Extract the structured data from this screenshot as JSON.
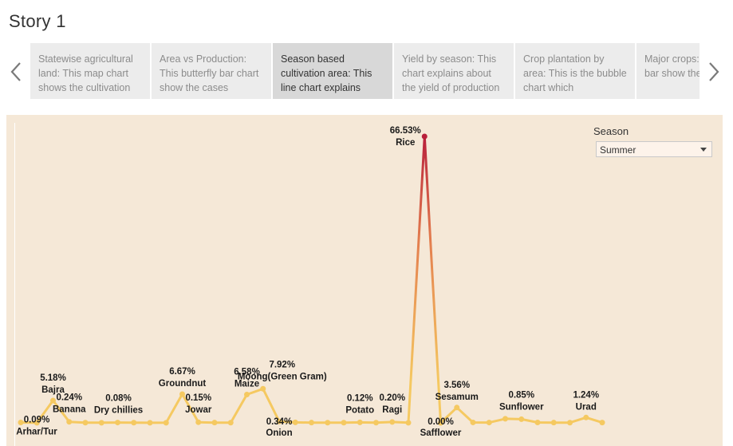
{
  "story": {
    "title": "Story 1"
  },
  "storypoints": [
    {
      "text": "Statewise agricultural land: This map chart shows the cultivation",
      "active": false
    },
    {
      "text": "Area vs Production: This butterfly bar chart show the cases",
      "active": false
    },
    {
      "text": "Season based cultivation area: This line chart explains",
      "active": true
    },
    {
      "text": "Yield by season: This chart explains about the yield of production",
      "active": false
    },
    {
      "text": "Crop plantation by area: This is the bubble chart which",
      "active": false
    },
    {
      "text": "Major crops: stacked bar show the crops",
      "active": false
    }
  ],
  "filter": {
    "label": "Season",
    "value": "Summer"
  },
  "colors": {
    "low": "#f5c961",
    "mid": "#e4804f",
    "high": "#b81f3a",
    "background": "#f5e8d7"
  },
  "chart_data": {
    "type": "line",
    "ylim": [
      0,
      70
    ],
    "points": [
      {
        "crop": "Arhar/Tur",
        "value": 0.09,
        "label": "0.09%",
        "labeled": true
      },
      {
        "crop": "",
        "value": 0.02,
        "label": "",
        "labeled": false
      },
      {
        "crop": "Bajra",
        "value": 5.18,
        "label": "5.18%",
        "labeled": true
      },
      {
        "crop": "Banana",
        "value": 0.24,
        "label": "0.24%",
        "labeled": true
      },
      {
        "crop": "",
        "value": 0.05,
        "label": "",
        "labeled": false
      },
      {
        "crop": "",
        "value": 0.03,
        "label": "",
        "labeled": false
      },
      {
        "crop": "Dry chillies",
        "value": 0.08,
        "label": "0.08%",
        "labeled": true
      },
      {
        "crop": "",
        "value": 0.04,
        "label": "",
        "labeled": false
      },
      {
        "crop": "",
        "value": 0.02,
        "label": "",
        "labeled": false
      },
      {
        "crop": "",
        "value": 0.03,
        "label": "",
        "labeled": false
      },
      {
        "crop": "Groundnut",
        "value": 6.67,
        "label": "6.67%",
        "labeled": true
      },
      {
        "crop": "Jowar",
        "value": 0.15,
        "label": "0.15%",
        "labeled": true
      },
      {
        "crop": "",
        "value": 0.06,
        "label": "",
        "labeled": false
      },
      {
        "crop": "",
        "value": 0.04,
        "label": "",
        "labeled": false
      },
      {
        "crop": "Maize",
        "value": 6.58,
        "label": "6.58%",
        "labeled": true
      },
      {
        "crop": "Moong(Green Gram)",
        "value": 7.92,
        "label": "7.92%",
        "labeled": true
      },
      {
        "crop": "Onion",
        "value": 0.34,
        "label": "0.34%",
        "labeled": true
      },
      {
        "crop": "",
        "value": 0.12,
        "label": "",
        "labeled": false
      },
      {
        "crop": "",
        "value": 0.06,
        "label": "",
        "labeled": false
      },
      {
        "crop": "",
        "value": 0.05,
        "label": "",
        "labeled": false
      },
      {
        "crop": "",
        "value": 0.04,
        "label": "",
        "labeled": false
      },
      {
        "crop": "Potato",
        "value": 0.12,
        "label": "0.12%",
        "labeled": true
      },
      {
        "crop": "",
        "value": 0.05,
        "label": "",
        "labeled": false
      },
      {
        "crop": "Ragi",
        "value": 0.2,
        "label": "0.20%",
        "labeled": true
      },
      {
        "crop": "",
        "value": 0.03,
        "label": "",
        "labeled": false
      },
      {
        "crop": "Rice",
        "value": 66.53,
        "label": "66.53%",
        "labeled": true
      },
      {
        "crop": "Safflower",
        "value": 0.0,
        "label": "0.00%",
        "labeled": true
      },
      {
        "crop": "Sesamum",
        "value": 3.56,
        "label": "3.56%",
        "labeled": true
      },
      {
        "crop": "",
        "value": 0.1,
        "label": "",
        "labeled": false
      },
      {
        "crop": "",
        "value": 0.08,
        "label": "",
        "labeled": false
      },
      {
        "crop": "",
        "value": 0.95,
        "label": "",
        "labeled": false
      },
      {
        "crop": "Sunflower",
        "value": 0.85,
        "label": "0.85%",
        "labeled": true
      },
      {
        "crop": "",
        "value": 0.09,
        "label": "",
        "labeled": false
      },
      {
        "crop": "",
        "value": 0.06,
        "label": "",
        "labeled": false
      },
      {
        "crop": "",
        "value": 0.05,
        "label": "",
        "labeled": false
      },
      {
        "crop": "Urad",
        "value": 1.24,
        "label": "1.24%",
        "labeled": true
      },
      {
        "crop": "",
        "value": 0.07,
        "label": "",
        "labeled": false
      }
    ]
  }
}
